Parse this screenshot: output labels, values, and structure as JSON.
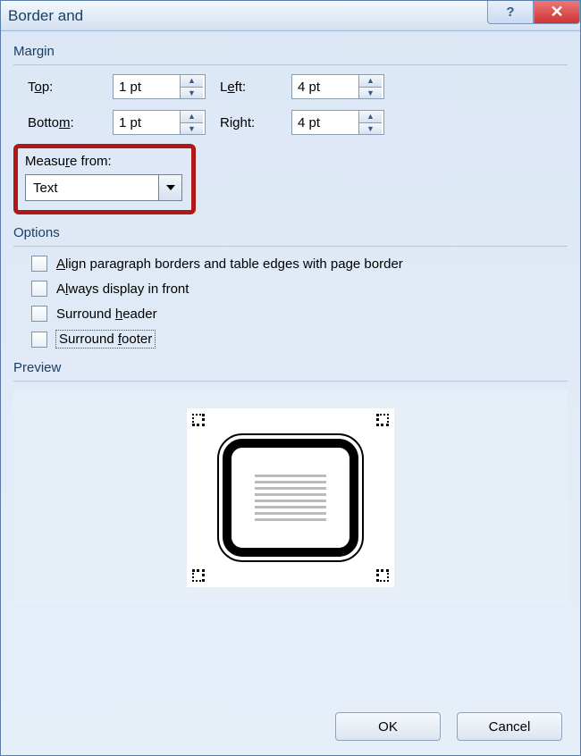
{
  "window": {
    "title": "Border and"
  },
  "margin": {
    "section_label": "Margin",
    "top_label_pre": "T",
    "top_label_u": "o",
    "top_label_post": "p:",
    "top_value": "1 pt",
    "bottom_label_pre": "Botto",
    "bottom_label_u": "m",
    "bottom_label_post": ":",
    "bottom_value": "1 pt",
    "left_label_pre": "L",
    "left_label_u": "e",
    "left_label_post": "ft:",
    "left_value": "4 pt",
    "right_label_pre": "Ri",
    "right_label_u": "g",
    "right_label_post": "ht:",
    "right_value": "4 pt"
  },
  "measure": {
    "label_pre": "Measu",
    "label_u": "r",
    "label_post": "e from:",
    "value": "Text"
  },
  "options": {
    "section_label": "Options",
    "align_pre": "",
    "align_u": "A",
    "align_post": "lign paragraph borders and table edges with page border",
    "always_pre": "A",
    "always_u": "l",
    "always_post": "ways display in front",
    "header_pre": "Surround ",
    "header_u": "h",
    "header_post": "eader",
    "footer_pre": "Surround ",
    "footer_u": "f",
    "footer_post": "ooter"
  },
  "preview": {
    "section_label": "Preview"
  },
  "buttons": {
    "ok": "OK",
    "cancel": "Cancel"
  }
}
